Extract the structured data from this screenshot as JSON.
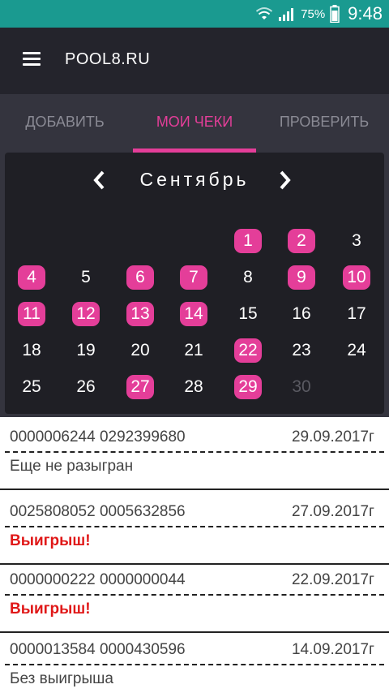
{
  "status_bar": {
    "battery": "75%",
    "time": "9:48",
    "icons": [
      "wifi-icon",
      "signal-icon",
      "battery-icon"
    ]
  },
  "app_bar": {
    "title": "POOL8.RU",
    "menu_icon": "hamburger-menu-icon"
  },
  "tabs": [
    {
      "label": "ДОБАВИТЬ",
      "active": false
    },
    {
      "label": "МОИ ЧЕКИ",
      "active": true
    },
    {
      "label": "ПРОВЕРИТЬ",
      "active": false
    }
  ],
  "calendar": {
    "month": "Сентябрь",
    "prev_icon": "chevron-left-icon",
    "next_icon": "chevron-right-icon",
    "first_weekday_index": 4,
    "days_in_month": 30,
    "marked_days": [
      1,
      2,
      4,
      6,
      7,
      9,
      10,
      11,
      12,
      13,
      14,
      22,
      27,
      29
    ],
    "dimmed_days": [
      30
    ]
  },
  "receipts": [
    {
      "numbers": "0000006244 0292399680",
      "date": "29.09.2017г",
      "status": "Еще не разыгран",
      "win": false
    },
    {
      "numbers": "0025808052 0005632856",
      "date": "27.09.2017г",
      "status": "Выигрыш!",
      "win": true
    },
    {
      "numbers": "0000000222 0000000044",
      "date": "22.09.2017г",
      "status": "Выигрыш!",
      "win": true
    },
    {
      "numbers": "0000013584 0000430596",
      "date": "14.09.2017г",
      "status": "Без выигрыша",
      "win": false
    }
  ],
  "colors": {
    "accent": "#e43e99",
    "status_bar": "#1a9a90",
    "win_text": "#e01818"
  }
}
